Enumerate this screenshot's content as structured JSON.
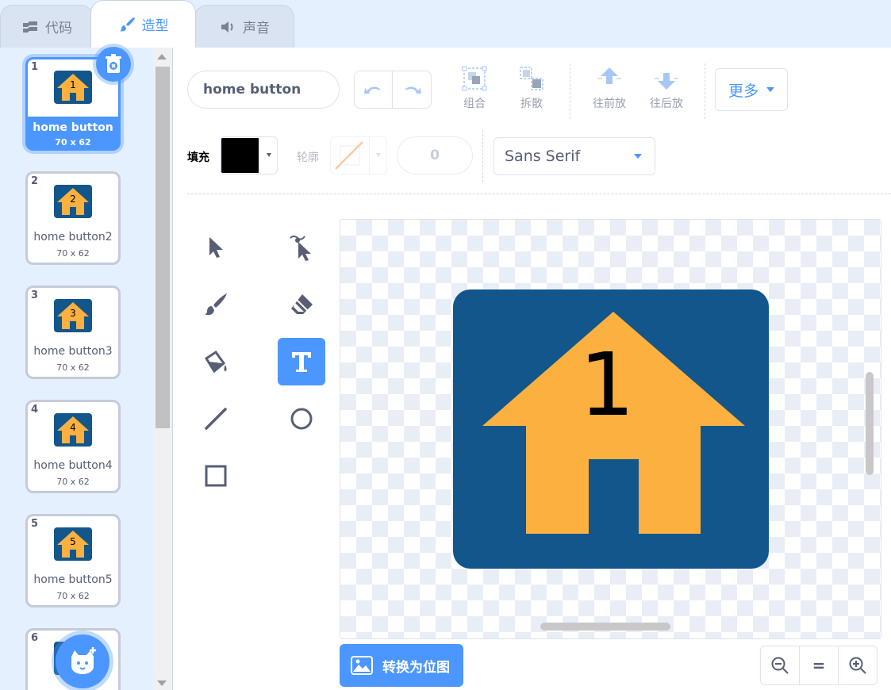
{
  "tabs": [
    {
      "label": "代码",
      "icon": "code-icon"
    },
    {
      "label": "造型",
      "icon": "brush-icon"
    },
    {
      "label": "声音",
      "icon": "speaker-icon"
    }
  ],
  "costumes": [
    {
      "num": "1",
      "name": "home button",
      "dims": "70 x 62",
      "selected": true
    },
    {
      "num": "2",
      "name": "home button2",
      "dims": "70 x 62"
    },
    {
      "num": "3",
      "name": "home button3",
      "dims": "70 x 62"
    },
    {
      "num": "4",
      "name": "home button4",
      "dims": "70 x 62"
    },
    {
      "num": "5",
      "name": "home button5",
      "dims": "70 x 62"
    },
    {
      "num": "6",
      "name": "",
      "dims": ""
    }
  ],
  "toolbar": {
    "costume_name": "home button",
    "group": "组合",
    "ungroup": "拆散",
    "forward": "往前放",
    "backward": "往后放",
    "more": "更多"
  },
  "properties": {
    "fill_label": "填充",
    "fill_color": "#000000",
    "outline_label": "轮廓",
    "outline_width": "0",
    "font": "Sans Serif"
  },
  "artwork": {
    "text": "1",
    "background_color": "#12568b",
    "house_color": "#fbb040"
  },
  "bottom": {
    "convert_label": "转换为位图",
    "zoom_reset": "="
  },
  "colors": {
    "accent": "#4c97ff",
    "tab_bg": "#e5f0ff"
  }
}
